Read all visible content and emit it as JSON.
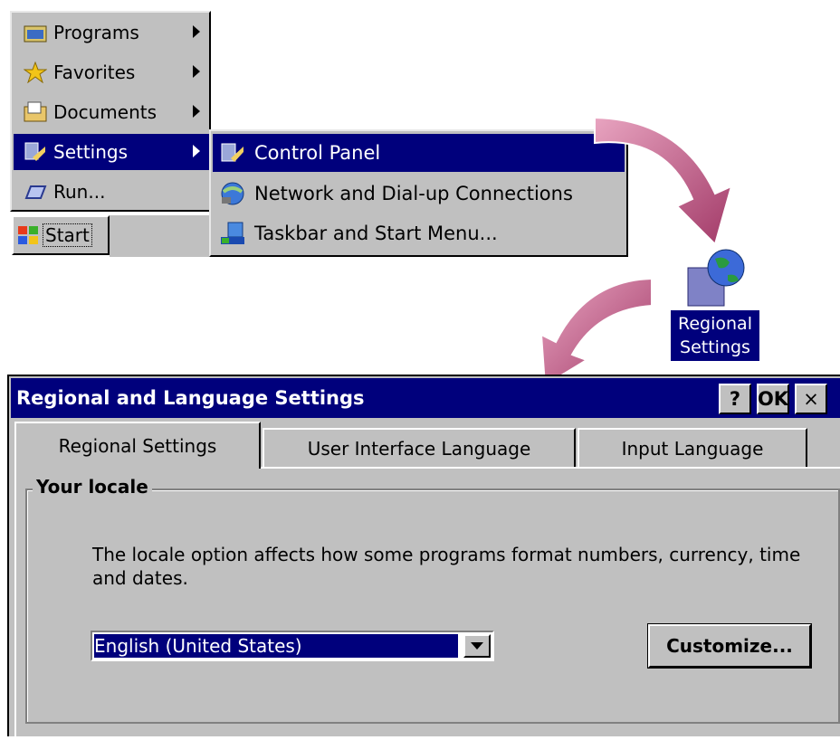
{
  "start_menu": {
    "items": [
      {
        "label": "Programs",
        "icon": "programs-folder-icon",
        "has_submenu": true
      },
      {
        "label": "Favorites",
        "icon": "star-icon",
        "has_submenu": true
      },
      {
        "label": "Documents",
        "icon": "documents-folder-icon",
        "has_submenu": true
      },
      {
        "label": "Settings",
        "icon": "settings-icon",
        "has_submenu": true,
        "selected": true
      },
      {
        "label": "Run...",
        "icon": "run-icon",
        "has_submenu": false
      }
    ],
    "start_button": "Start"
  },
  "settings_submenu": {
    "items": [
      {
        "label": "Control Panel",
        "icon": "control-panel-icon",
        "selected": true
      },
      {
        "label": "Network and Dial-up Connections",
        "icon": "network-icon"
      },
      {
        "label": "Taskbar and Start Menu...",
        "icon": "taskbar-icon"
      }
    ]
  },
  "control_panel_item": {
    "label_line1": "Regional",
    "label_line2": "Settings",
    "icon": "globe-icon"
  },
  "dialog": {
    "title": "Regional and Language Settings",
    "help_button": "?",
    "ok_button": "OK",
    "close_button": "×",
    "tabs": [
      "Regional Settings",
      "User Interface Language",
      "Input Language"
    ],
    "active_tab": 0,
    "group_label": "Your locale",
    "description": "The locale option affects how some programs format numbers, currency, time and dates.",
    "locale_value": "English (United States)",
    "customize_button": "Customize..."
  },
  "colors": {
    "selection": "#00007c",
    "face": "#c0c0c0",
    "arrow": "#b0466e"
  }
}
